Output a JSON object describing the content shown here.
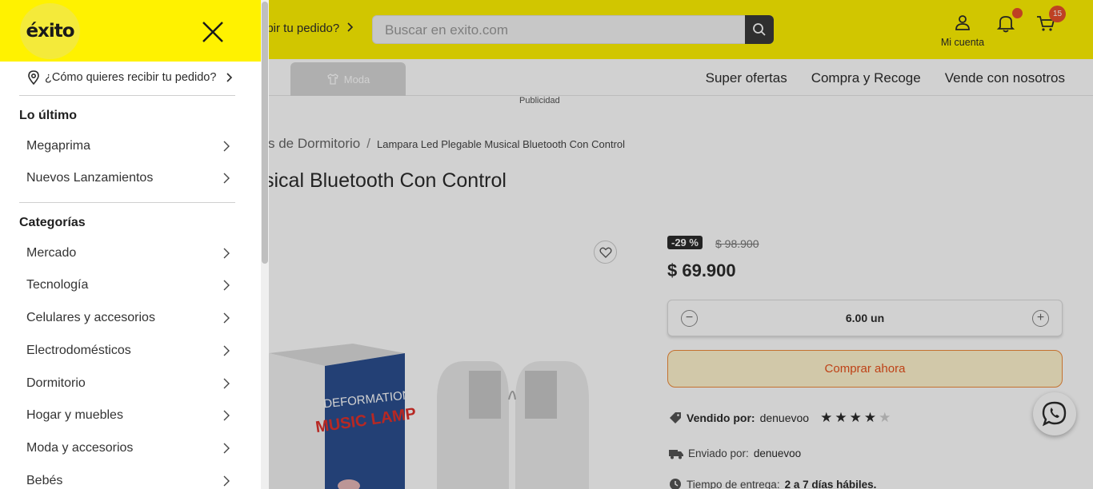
{
  "header": {
    "delivery_link": "ibir tu pedido?",
    "search_placeholder": "Buscar en exito.com",
    "account_label": "Mi cuenta",
    "cart_count": "15"
  },
  "nav": {
    "moda_label": "Moda",
    "links": [
      "Super ofertas",
      "Compra y Recoge",
      "Vende con nosotros"
    ],
    "ads_label": "Publicidad"
  },
  "breadcrumb": {
    "category": "s de Dormitorio",
    "separator": "/",
    "current": "Lampara Led Plegable Musical Bluetooth Con Control"
  },
  "product": {
    "title": "sical Bluetooth Con Control",
    "image_text_1": "DEFORMATION",
    "image_text_2": "MUSIC LAMP",
    "discount": "-29 %",
    "old_price": "$ 98.900",
    "price": "$ 69.900",
    "quantity": "6.00 un",
    "buy_label": "Comprar ahora",
    "sold_by_label": "Vendido por:",
    "sold_by_value": "denuevoo",
    "rating": 4,
    "rating_max": 5,
    "shipped_by_label": "Enviado por:",
    "shipped_by_value": "denuevoo",
    "delivery_time_label": "Tiempo de entrega:",
    "delivery_time_value": "2 a 7 días hábiles."
  },
  "drawer": {
    "logo": "éxito",
    "delivery_prompt": "¿Cómo quieres recibir tu pedido?",
    "sections": [
      {
        "title": "Lo último",
        "items": [
          "Megaprima",
          "Nuevos Lanzamientos"
        ]
      },
      {
        "title": "Categorías",
        "items": [
          "Mercado",
          "Tecnología",
          "Celulares y accesorios",
          "Electrodomésticos",
          "Dormitorio",
          "Hogar y muebles",
          "Moda y accesorios",
          "Bebés"
        ]
      }
    ]
  },
  "colors": {
    "brand_yellow": "#fff200",
    "accent_orange": "#e8502b",
    "dark": "#2b2b2b"
  }
}
